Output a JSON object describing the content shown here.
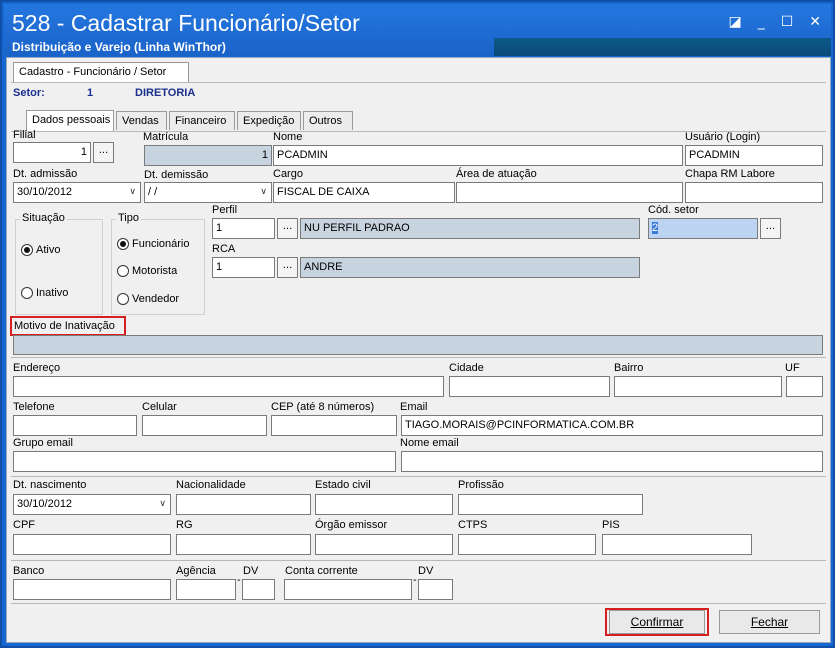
{
  "window": {
    "title": "528 - Cadastrar Funcionário/Setor",
    "subtitle": "Distribuição e Varejo (Linha WinThor)",
    "controls": [
      "restore-icon",
      "minimize-icon",
      "maximize-icon",
      "close-icon"
    ],
    "control_glyphs": {
      "restore": "◪",
      "minimize": "_",
      "maximize": "☐",
      "close": "✕"
    }
  },
  "main_tab": "Cadastro - Funcionário / Setor",
  "setor": {
    "label": "Setor:",
    "code": "1",
    "name": "DIRETORIA"
  },
  "tabs": [
    "Dados pessoais",
    "Vendas",
    "Financeiro",
    "Expedição",
    "Outros"
  ],
  "form": {
    "filial": {
      "label": "Filial",
      "value": "1"
    },
    "matricula": {
      "label": "Matrícula",
      "value": "1"
    },
    "nome": {
      "label": "Nome",
      "value": "PCADMIN"
    },
    "usuario": {
      "label": "Usuário (Login)",
      "value": "PCADMIN"
    },
    "dt_admissao": {
      "label": "Dt. admissão",
      "value": "30/10/2012"
    },
    "dt_demissao": {
      "label": "Dt.  demissão",
      "value": " / /"
    },
    "cargo": {
      "label": "Cargo",
      "value": "FISCAL DE CAIXA"
    },
    "area_atuacao": {
      "label": "Área de atuação",
      "value": ""
    },
    "chapa": {
      "label": "Chapa RM Labore",
      "value": ""
    },
    "situacao": {
      "label": "Situação",
      "options": [
        "Ativo",
        "Inativo"
      ],
      "selected": "Ativo"
    },
    "tipo": {
      "label": "Tipo",
      "options": [
        "Funcionário",
        "Motorista",
        "Vendedor"
      ],
      "selected": "Funcionário"
    },
    "perfil": {
      "label": "Perfil",
      "code": "1",
      "desc": "NU  PERFIL PADRAO"
    },
    "rca": {
      "label": "RCA",
      "code": "1",
      "desc": "ANDRE"
    },
    "cod_setor": {
      "label": "Cód. setor",
      "value": "2"
    },
    "motivo_inativacao": {
      "label": "Motivo de Inativação",
      "value": ""
    },
    "endereco": {
      "label": "Endereço",
      "value": ""
    },
    "cidade": {
      "label": "Cidade",
      "value": ""
    },
    "bairro": {
      "label": "Bairro",
      "value": ""
    },
    "uf": {
      "label": "UF",
      "value": ""
    },
    "telefone": {
      "label": "Telefone",
      "value": ""
    },
    "celular": {
      "label": "Celular",
      "value": ""
    },
    "cep": {
      "label": "CEP (até 8 números)",
      "value": ""
    },
    "email": {
      "label": "Email",
      "value": "TIAGO.MORAIS@PCINFORMATICA.COM.BR"
    },
    "grupo_email": {
      "label": "Grupo email",
      "value": ""
    },
    "nome_email": {
      "label": "Nome email",
      "value": ""
    },
    "dt_nascimento": {
      "label": "Dt. nascimento",
      "value": "30/10/2012"
    },
    "nacionalidade": {
      "label": "Nacionalidade",
      "value": ""
    },
    "estado_civil": {
      "label": "Estado civil",
      "value": ""
    },
    "profissao": {
      "label": "Profissão",
      "value": ""
    },
    "cpf": {
      "label": "CPF",
      "value": ""
    },
    "rg": {
      "label": "RG",
      "value": ""
    },
    "orgao_emissor": {
      "label": "Órgão emissor",
      "value": ""
    },
    "ctps": {
      "label": "CTPS",
      "value": ""
    },
    "pis": {
      "label": "PIS",
      "value": ""
    },
    "banco": {
      "label": "Banco",
      "value": ""
    },
    "agencia": {
      "label": "Agência",
      "value": ""
    },
    "dv1": {
      "label": "DV",
      "value": ""
    },
    "conta_corrente": {
      "label": "Conta corrente",
      "value": ""
    },
    "dv2": {
      "label": "DV",
      "value": ""
    },
    "dash": "-"
  },
  "buttons": {
    "lookup": "...",
    "confirmar": "Confirmar",
    "fechar": "Fechar"
  },
  "colors": {
    "title_bar": "#1a63c8",
    "readonly_field": "#c8d3e0",
    "highlight_border": "#d62020",
    "selected_field": "#bcd4f2"
  }
}
